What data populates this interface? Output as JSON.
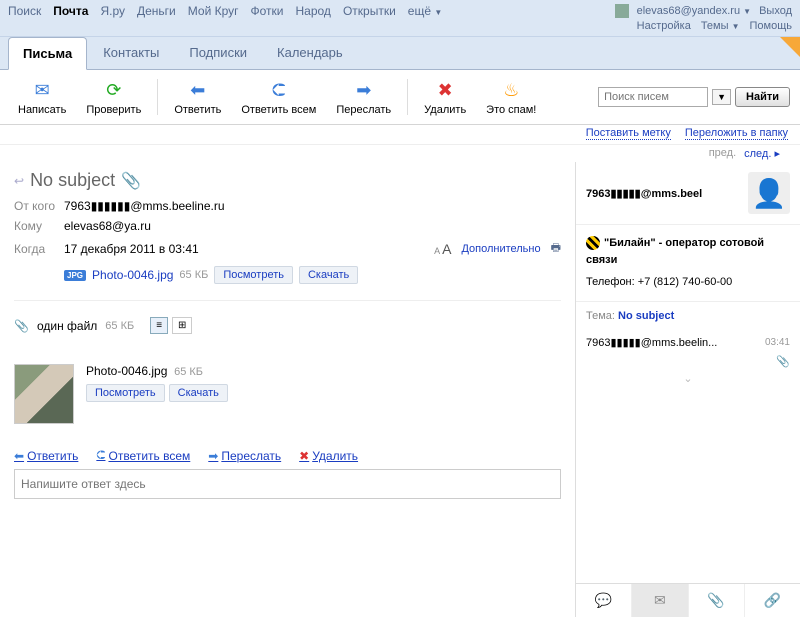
{
  "topnav": {
    "links": [
      "Поиск",
      "Почта",
      "Я.ру",
      "Деньги",
      "Мой Круг",
      "Фотки",
      "Народ",
      "Открытки",
      "ещё"
    ],
    "active_index": 1,
    "user": "elevas68@yandex.ru",
    "logout": "Выход",
    "settings": "Настройка",
    "themes": "Темы",
    "help": "Помощь"
  },
  "tabs": {
    "items": [
      "Письма",
      "Контакты",
      "Подписки",
      "Календарь"
    ],
    "active_index": 0
  },
  "toolbar": {
    "compose": "Написать",
    "check": "Проверить",
    "reply": "Ответить",
    "reply_all": "Ответить всем",
    "forward": "Переслать",
    "delete": "Удалить",
    "spam": "Это спам!",
    "search_placeholder": "Поиск писем",
    "find": "Найти",
    "set_label": "Поставить метку",
    "move_folder": "Переложить в папку"
  },
  "nav": {
    "prev": "пред.",
    "next": "след."
  },
  "message": {
    "subject": "No subject",
    "from_label": "От кого",
    "from": "7963▮▮▮▮▮▮@mms.beeline.ru",
    "to_label": "Кому",
    "to": "elevas68@ya.ru",
    "date_label": "Когда",
    "date": "17 декабря 2011 в 03:41",
    "more": "Дополнительно",
    "attachment": {
      "name": "Photo-0046.jpg",
      "size": "65 КБ",
      "view": "Посмотреть",
      "download": "Скачать"
    },
    "files_header": "один файл",
    "files_size": "65 КБ"
  },
  "actions": {
    "reply": "Ответить",
    "reply_all": "Ответить всем",
    "forward": "Переслать",
    "delete": "Удалить"
  },
  "reply_placeholder": "Напишите ответ здесь",
  "sidebar": {
    "contact": "7963▮▮▮▮▮@mms.beel",
    "operator": "\"Билайн\" - оператор сотовой связи",
    "phone_label": "Телефон:",
    "phone": "+7 (812) 740-60-00",
    "thread_label": "Тема:",
    "thread_subject": "No subject",
    "msg_from": "7963▮▮▮▮▮@mms.beelin...",
    "msg_time": "03:41"
  }
}
